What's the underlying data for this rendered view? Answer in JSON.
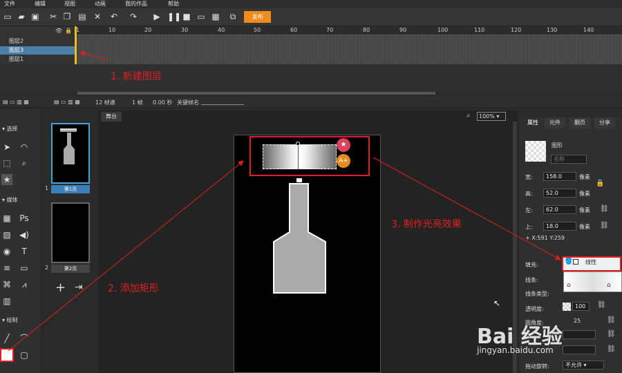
{
  "menu": [
    "文件",
    "编辑",
    "视图",
    "动画",
    "我的作品",
    "帮助"
  ],
  "toolbar": {
    "publish": "发布"
  },
  "timeline": {
    "ticks": [
      "1",
      "10",
      "20",
      "30",
      "40",
      "50",
      "60",
      "70",
      "80",
      "90",
      "100",
      "110",
      "120",
      "130",
      "140"
    ],
    "layers": [
      "图层2",
      "图层3",
      "图层1"
    ],
    "fps": "12 帧速",
    "frame": "1 帧",
    "time": "0.00 秒",
    "keyframe_label": "关键帧名"
  },
  "left": {
    "sections": [
      "选择",
      "媒体",
      "绘制"
    ]
  },
  "pages": [
    {
      "num": "1",
      "label": "第1页"
    },
    {
      "num": "2",
      "label": "第2页"
    }
  ],
  "stage": {
    "tab": "舞台",
    "zoom": "100%"
  },
  "right": {
    "tabs": [
      "属性",
      "元件",
      "翻页",
      "分享"
    ],
    "shape_label": "图形",
    "name_placeholder": "名称",
    "w_label": "宽:",
    "w_val": "158.0",
    "h_label": "高:",
    "h_val": "52.0",
    "l_label": "左:",
    "l_val": "62.0",
    "t_label": "上:",
    "t_val": "18.0",
    "unit": "像素",
    "coords": "+ X:591   Y:259",
    "fill_label": "填充:",
    "fill_type": "线性",
    "stroke_label": "线条:",
    "stroke_type_label": "线条类型:",
    "opacity_label": "透明度:",
    "opacity_val": "100",
    "corner_label": "圆角度:",
    "corner_val": "25",
    "drag_label": "拖动旋转:",
    "drag_val": "不允许"
  },
  "annotations": {
    "a1": "1. 新建图层",
    "a2": "2. 添加矩形",
    "a3": "3. 制作光亮效果"
  },
  "watermark": {
    "text": "Bai 经验",
    "url": "jingyan.baidu.com"
  }
}
